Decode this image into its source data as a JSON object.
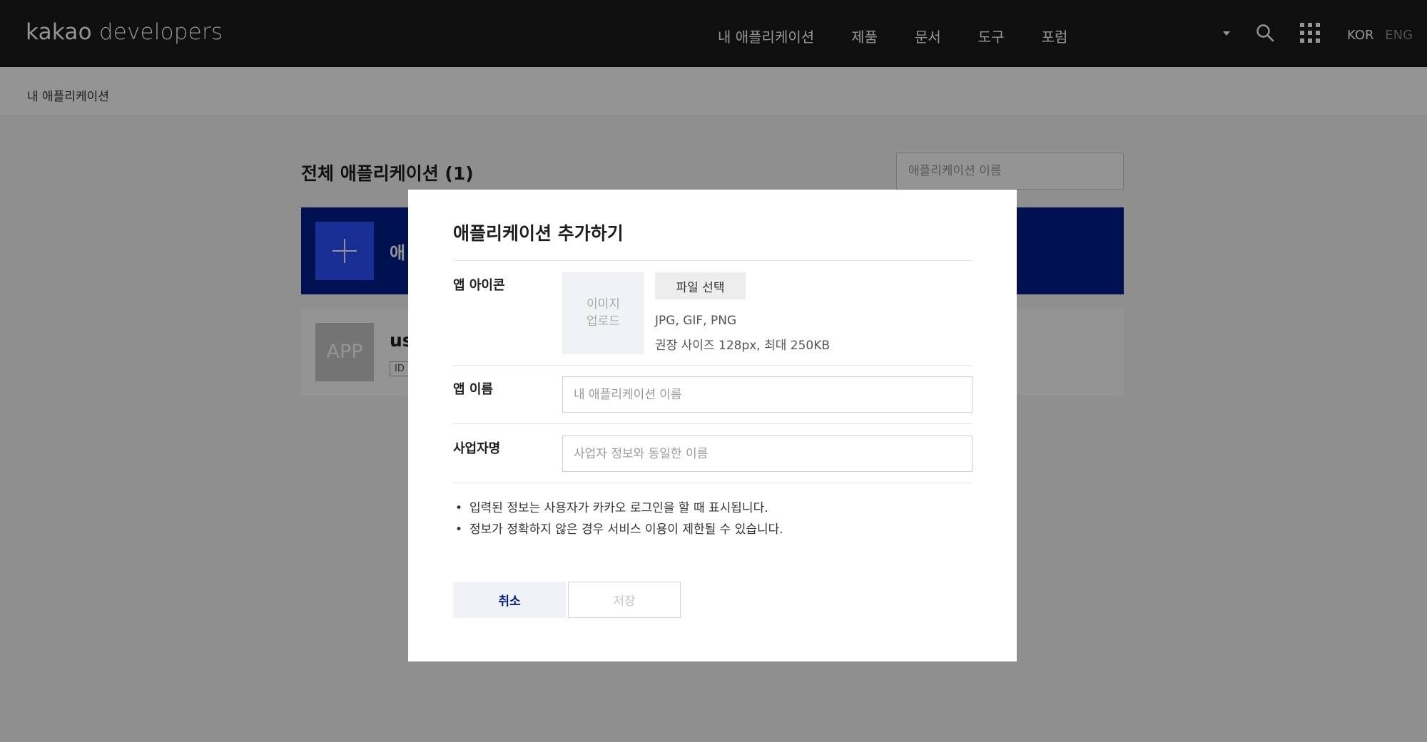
{
  "header": {
    "logo_bold": "kakao",
    "logo_light": "developers",
    "nav": [
      "내 애플리케이션",
      "제품",
      "문서",
      "도구",
      "포럼"
    ],
    "lang_active": "KOR",
    "lang_inactive": "ENG",
    "icons": [
      "caret-down-icon",
      "search-icon",
      "apps-grid-icon"
    ]
  },
  "breadcrumb": "내 애플리케이션",
  "main": {
    "title": "전체 애플리케이션 (1)",
    "search_placeholder": "애플리케이션 이름",
    "add_card_label": "애",
    "app_thumb": "APP",
    "app_name": "us",
    "app_id_label": "ID"
  },
  "modal": {
    "title": "애플리케이션 추가하기",
    "icon_label": "앱 아이콘",
    "upload_placeholder_line1": "이미지",
    "upload_placeholder_line2": "업로드",
    "file_button": "파일 선택",
    "formats": "JPG, GIF, PNG",
    "size_hint": "권장 사이즈 128px, 최대 250KB",
    "app_name_label": "앱 이름",
    "app_name_placeholder": "내 애플리케이션 이름",
    "company_label": "사업자명",
    "company_placeholder": "사업자 정보와 동일한 이름",
    "notes": [
      "입력된 정보는 사용자가 카카오 로그인을 할 때 표시됩니다.",
      "정보가 정확하지 않은 경우 서비스 이용이 제한될 수 있습니다."
    ],
    "cancel_button": "취소",
    "save_button": "저장"
  },
  "colors": {
    "header_bg": "#1a1a1a",
    "brand_navy": "#001e8c",
    "brand_blue": "#2b50ff"
  }
}
